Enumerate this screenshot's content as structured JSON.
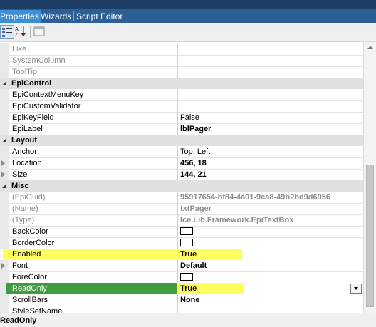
{
  "tabs": [
    {
      "label": "Properties",
      "active": true
    },
    {
      "label": "Wizards",
      "active": false
    },
    {
      "label": "Script Editor",
      "active": false
    }
  ],
  "toolbar": {
    "categorized_icon": "categorized-view-icon",
    "alphabetical_icon": "alphabetical-sort-icon",
    "pages_icon": "property-pages-icon"
  },
  "rows": {
    "like": {
      "name": "Like",
      "value": ""
    },
    "system_column": {
      "name": "SystemColumn",
      "value": ""
    },
    "tool_tip": {
      "name": "ToolTip",
      "value": ""
    },
    "epi_context_menu_key": {
      "name": "EpiContextMenuKey",
      "value": ""
    },
    "epi_custom_validator": {
      "name": "EpiCustomValidator",
      "value": ""
    },
    "epi_key_field": {
      "name": "EpiKeyField",
      "value": "False"
    },
    "epi_label": {
      "name": "EpiLabel",
      "value": "lblPager"
    },
    "anchor": {
      "name": "Anchor",
      "value": "Top, Left"
    },
    "location": {
      "name": "Location",
      "value": "456, 18"
    },
    "size": {
      "name": "Size",
      "value": "144, 21"
    },
    "epi_guid": {
      "name": "(EpiGuid)",
      "value": "95917654-bf84-4a01-9ca8-49b2bd9d6956"
    },
    "name": {
      "name": "(Name)",
      "value": "txtPager"
    },
    "type": {
      "name": "(Type)",
      "value": "Ice.Lib.Framework.EpiTextBox"
    },
    "back_color": {
      "name": "BackColor",
      "value": ""
    },
    "border_color": {
      "name": "BorderColor",
      "value": ""
    },
    "enabled": {
      "name": "Enabled",
      "value": "True"
    },
    "font": {
      "name": "Font",
      "value": "Default"
    },
    "fore_color": {
      "name": "ForeColor",
      "value": ""
    },
    "read_only": {
      "name": "ReadOnly",
      "value": "True"
    },
    "scroll_bars": {
      "name": "ScrollBars",
      "value": "None"
    },
    "style_set_name": {
      "name": "StyleSetName",
      "value": ""
    }
  },
  "categories": {
    "epi_control": "EpiControl",
    "layout": "Layout",
    "misc": "Misc"
  },
  "colors": {
    "back_color_swatch": "#ffffff",
    "border_color_swatch": "#ffffff",
    "fore_color_swatch": "#ffffff",
    "highlight_yellow": "#fefe5c",
    "selected_green": "#3f9d3f"
  },
  "status": {
    "text": "ReadOnly"
  }
}
